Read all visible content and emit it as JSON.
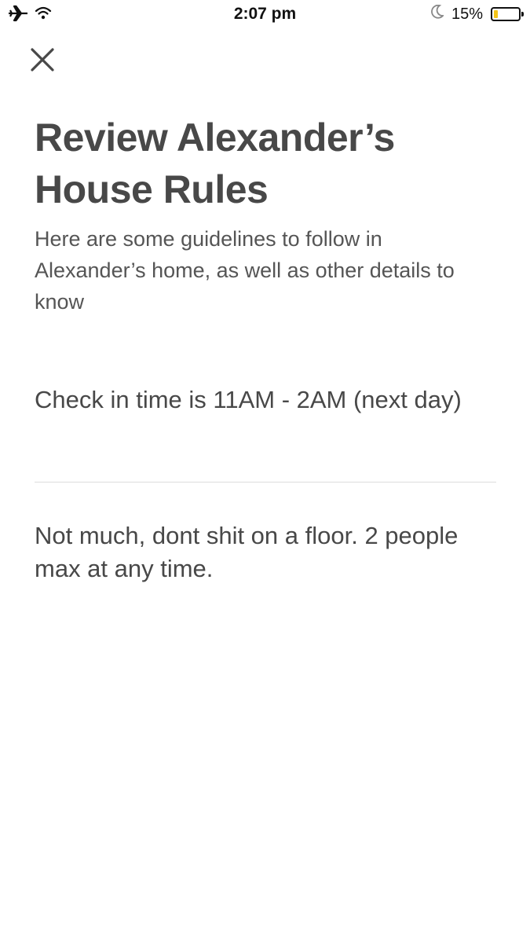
{
  "status_bar": {
    "time": "2:07 pm",
    "battery_percent": "15%",
    "battery_level": 0.15,
    "battery_fill_color": "#f5c518",
    "icons": [
      "airplane-icon",
      "wifi-icon",
      "moon-icon",
      "battery-icon"
    ]
  },
  "header": {
    "close_icon": "close-icon"
  },
  "main": {
    "title": "Review Alexander’s House Rules",
    "subtitle": "Here are some guidelines to follow in Alexander’s home, as well as other details to know",
    "checkin_text": "Check in time is 11AM - 2AM (next day)",
    "rules_text": "Not much, dont shit on a floor. 2 people max at any time."
  },
  "colors": {
    "text_primary": "#484848",
    "divider": "#dcdcdc",
    "background": "#ffffff"
  }
}
